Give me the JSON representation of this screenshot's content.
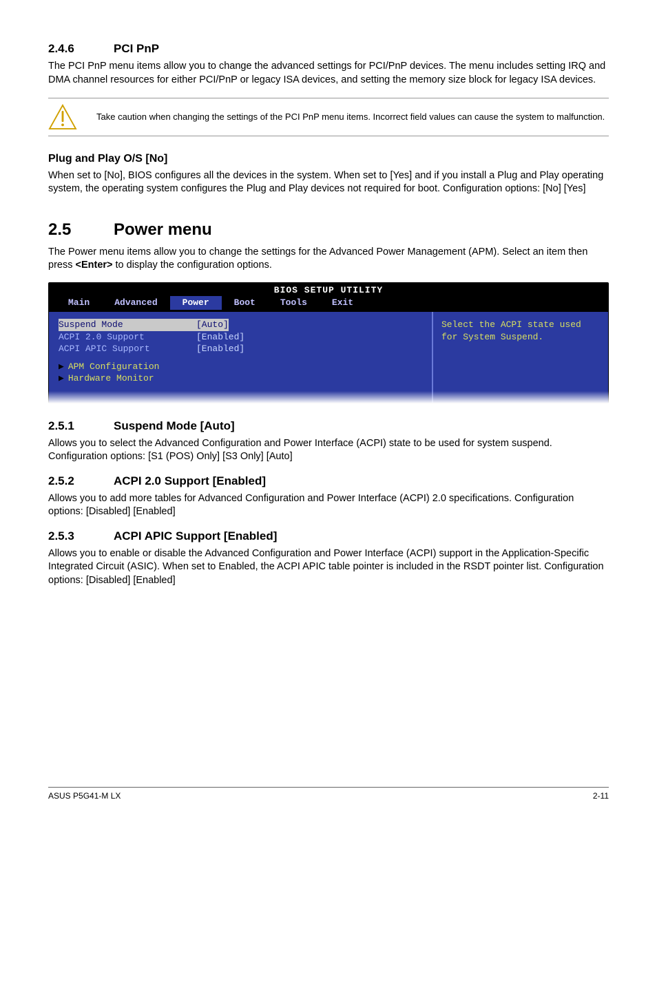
{
  "s246": {
    "num": "2.4.6",
    "title": "PCI PnP",
    "para": "The PCI PnP menu items allow you to change the advanced settings for PCI/PnP devices. The menu includes setting IRQ and DMA channel resources for either PCI/PnP or legacy ISA devices, and setting the memory size block for legacy ISA devices."
  },
  "caution": "Take caution when changing the settings of the PCI PnP menu items. Incorrect field values can cause the system to malfunction.",
  "plug": {
    "heading": "Plug and Play O/S [No]",
    "para": "When set to [No], BIOS configures all the devices in the system. When set to [Yes] and if you install a Plug and Play operating system, the operating system configures the Plug and Play devices not required for boot. Configuration options: [No] [Yes]"
  },
  "s25": {
    "num": "2.5",
    "title": "Power menu",
    "para_pre": "The Power menu items allow you to change the settings for the Advanced Power Management (APM). Select an item then press ",
    "enter": "<Enter>",
    "para_post": " to display the configuration options."
  },
  "bios": {
    "title": "BIOS SETUP UTILITY",
    "tabs": {
      "main": "Main",
      "advanced": "Advanced",
      "power": "Power",
      "boot": "Boot",
      "tools": "Tools",
      "exit": "Exit"
    },
    "rows": {
      "suspend_label": "Suspend Mode",
      "suspend_val": "[Auto]",
      "acpi20_label": "ACPI 2.0 Support",
      "acpi20_val": "[Enabled]",
      "apic_label": "ACPI APIC Support",
      "apic_val": "[Enabled]"
    },
    "subs": {
      "apm": "APM Configuration",
      "hw": "Hardware Monitor"
    },
    "help": "Select the ACPI state used for System Suspend."
  },
  "s251": {
    "num": "2.5.1",
    "title": "Suspend Mode [Auto]",
    "para": "Allows you to select the Advanced Configuration and Power Interface (ACPI) state to be used for system suspend. Configuration options: [S1 (POS) Only] [S3 Only] [Auto]"
  },
  "s252": {
    "num": "2.5.2",
    "title": "ACPI 2.0 Support [Enabled]",
    "para": "Allows you to add more tables for Advanced Configuration and Power Interface (ACPI) 2.0 specifications. Configuration options: [Disabled] [Enabled]"
  },
  "s253": {
    "num": "2.5.3",
    "title": "ACPI APIC Support [Enabled]",
    "para": "Allows you to enable or disable the Advanced Configuration and Power Interface (ACPI) support in the Application-Specific Integrated Circuit (ASIC). When set to Enabled, the ACPI APIC table pointer is included in the RSDT pointer list. Configuration options: [Disabled] [Enabled]"
  },
  "footer": {
    "left": "ASUS P5G41-M LX",
    "right": "2-11"
  }
}
